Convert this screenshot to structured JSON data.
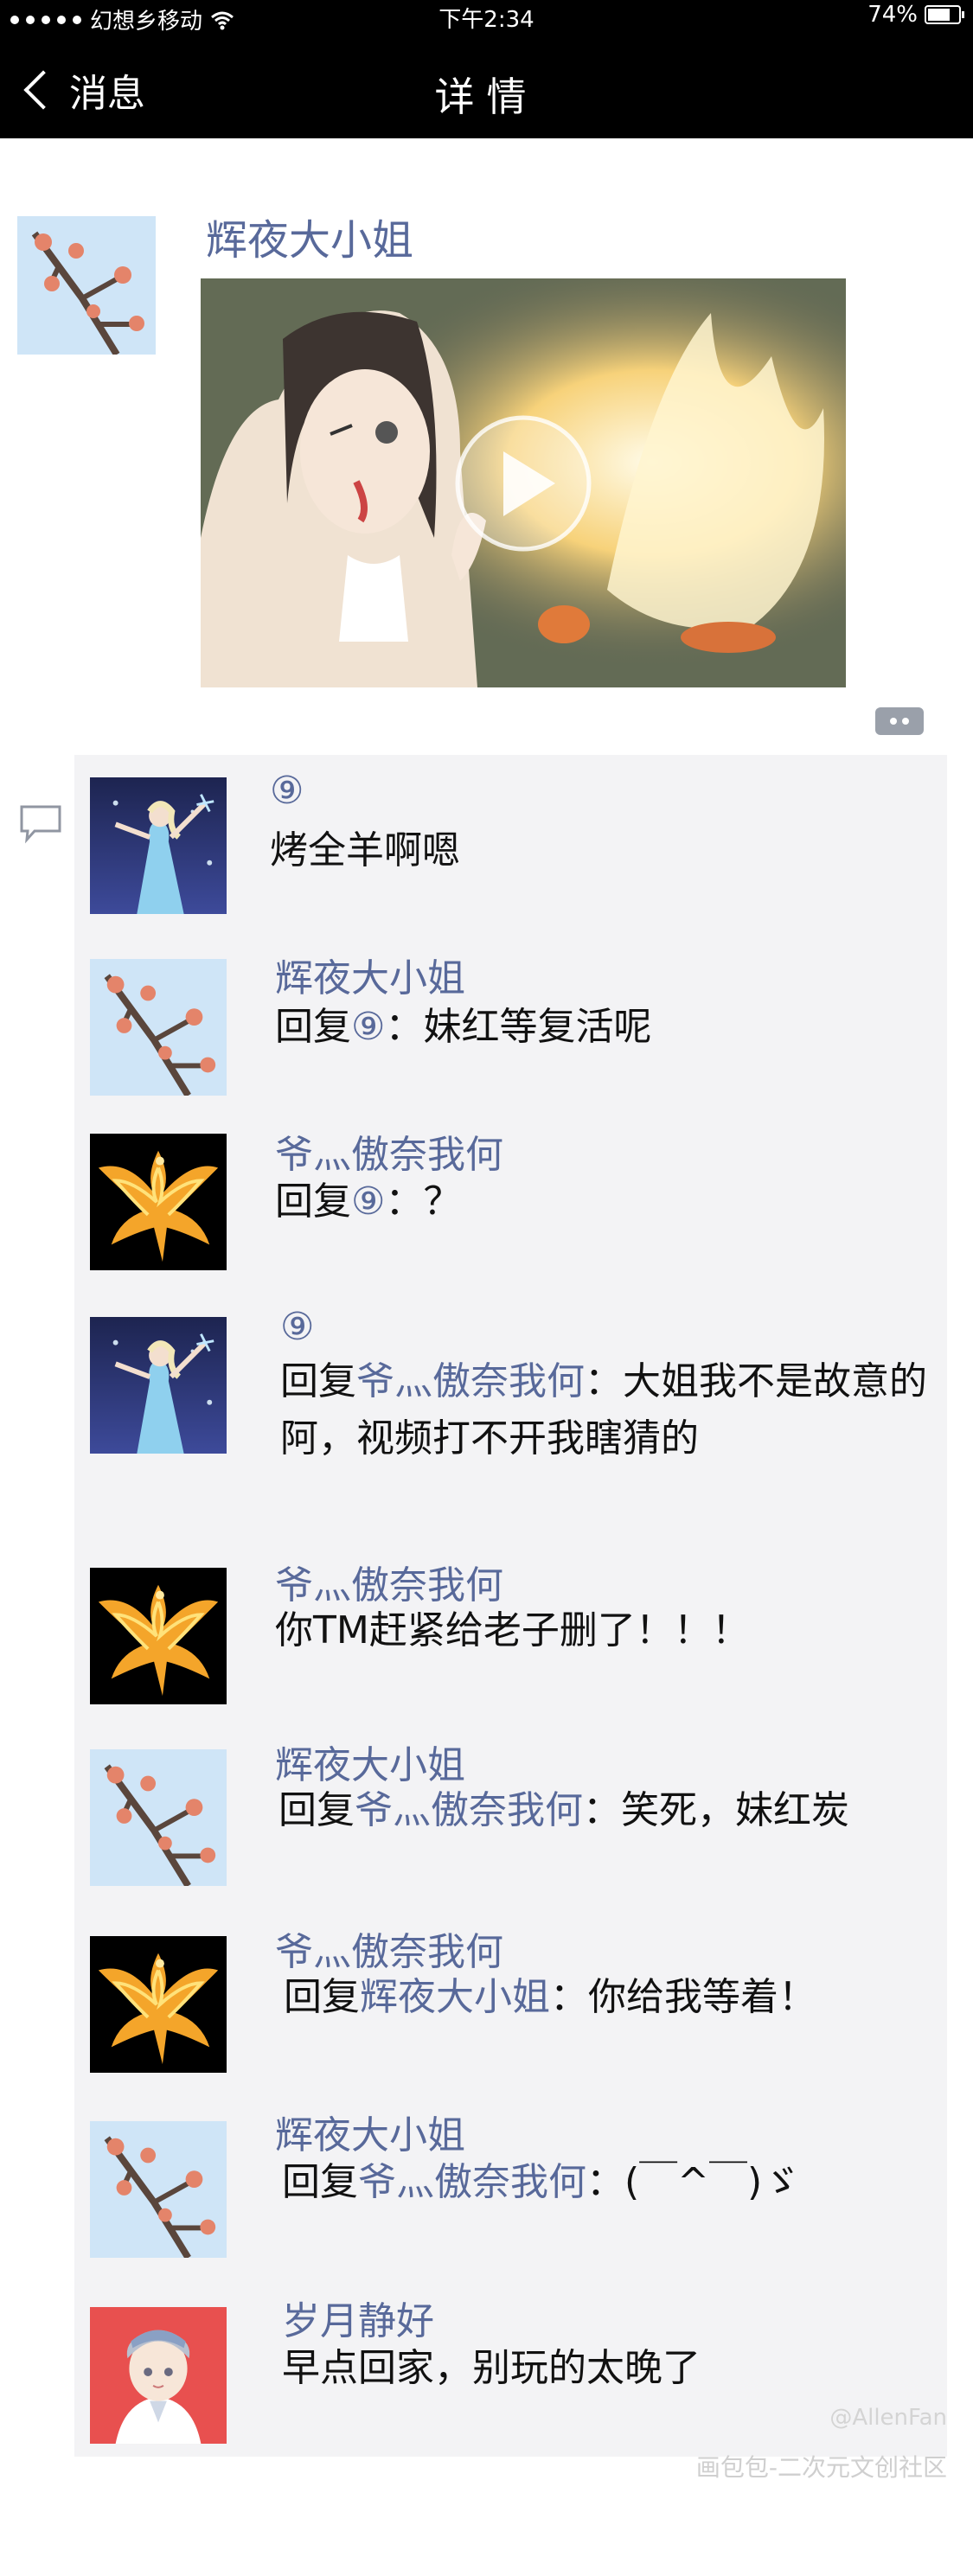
{
  "status_bar": {
    "carrier": "幻想乡移动",
    "time": "下午2:34",
    "battery": "74%",
    "battery_level": 0.74
  },
  "nav": {
    "back_label": "消息",
    "title": "详情"
  },
  "post": {
    "author": "辉夜大小姐",
    "media_type": "video",
    "icons": {
      "play": "play-icon",
      "more": "more-icon",
      "comment": "comment-icon"
    }
  },
  "comments": [
    {
      "name": "⑨",
      "prefix": "",
      "target": "",
      "sep": "",
      "text": "烤全羊啊嗯",
      "avatar": "elsa"
    },
    {
      "name": "辉夜大小姐",
      "prefix": "回复",
      "target": "⑨",
      "sep": "：",
      "text": "妹红等复活呢",
      "avatar": "plum"
    },
    {
      "name": "爷灬傲奈我何",
      "prefix": "回复",
      "target": "⑨",
      "sep": "：",
      "text": "？",
      "avatar": "phoenix"
    },
    {
      "name": "⑨",
      "prefix": "回复",
      "target": "爷灬傲奈我何",
      "sep": "：",
      "text": "大姐我不是故意的阿，视频打不开我瞎猜的",
      "avatar": "elsa"
    },
    {
      "name": "爷灬傲奈我何",
      "prefix": "",
      "target": "",
      "sep": "",
      "text": "你TM赶紧给老子删了！！！",
      "avatar": "phoenix"
    },
    {
      "name": "辉夜大小姐",
      "prefix": "回复",
      "target": "爷灬傲奈我何",
      "sep": "：",
      "text": "笑死，妹红炭",
      "avatar": "plum"
    },
    {
      "name": "爷灬傲奈我何",
      "prefix": "回复",
      "target": "辉夜大小姐",
      "sep": "：",
      "text": "你给我等着！",
      "avatar": "phoenix"
    },
    {
      "name": "辉夜大小姐",
      "prefix": "回复",
      "target": "爷灬傲奈我何",
      "sep": "：",
      "text": "(￣^￣)ゞ",
      "avatar": "plum"
    },
    {
      "name": "岁月静好",
      "prefix": "",
      "target": "",
      "sep": "",
      "text": "早点回家，别玩的太晚了",
      "avatar": "chibi"
    }
  ],
  "watermark": {
    "handle": "@AllenFan",
    "site": "画包包-二次元文创社区"
  }
}
